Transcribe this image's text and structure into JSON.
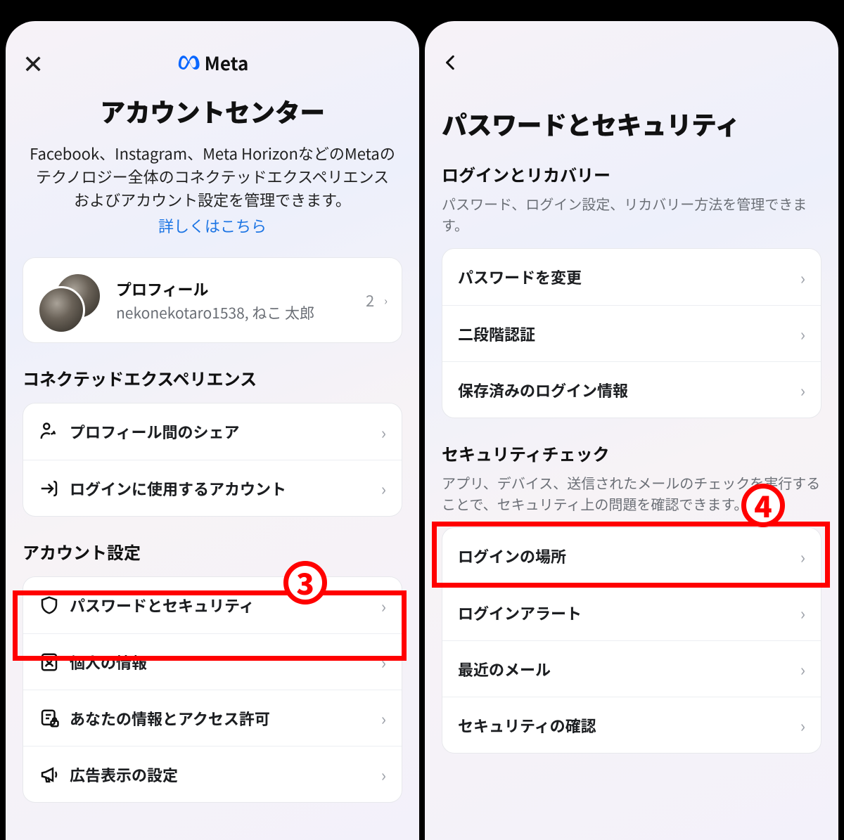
{
  "left": {
    "brand": "Meta",
    "title": "アカウントセンター",
    "description": "Facebook、Instagram、Meta HorizonなどのMetaのテクノロジー全体のコネクテッドエクスペリエンスおよびアカウント設定を管理できます。",
    "learn_more": "詳しくはこちら",
    "profile": {
      "heading": "プロフィール",
      "subtitle": "nekonekotaro1538, ねこ 太郎",
      "count": "2"
    },
    "section_connected": "コネクテッドエクスペリエンス",
    "rows_connected": [
      "プロフィール間のシェア",
      "ログインに使用するアカウント"
    ],
    "section_account": "アカウント設定",
    "rows_account": [
      "パスワードとセキュリティ",
      "個人の情報",
      "あなたの情報とアクセス許可",
      "広告表示の設定"
    ]
  },
  "right": {
    "title": "パスワードとセキュリティ",
    "section_login": {
      "heading": "ログインとリカバリー",
      "sub": "パスワード、ログイン設定、リカバリー方法を管理できます。",
      "rows": [
        "パスワードを変更",
        "二段階認証",
        "保存済みのログイン情報"
      ]
    },
    "section_check": {
      "heading": "セキュリティチェック",
      "sub": "アプリ、デバイス、送信されたメールのチェックを実行することで、セキュリティ上の問題を確認できます。",
      "rows": [
        "ログインの場所",
        "ログインアラート",
        "最近のメール",
        "セキュリティの確認"
      ]
    }
  },
  "annot": {
    "n3": "3",
    "n4": "4"
  }
}
